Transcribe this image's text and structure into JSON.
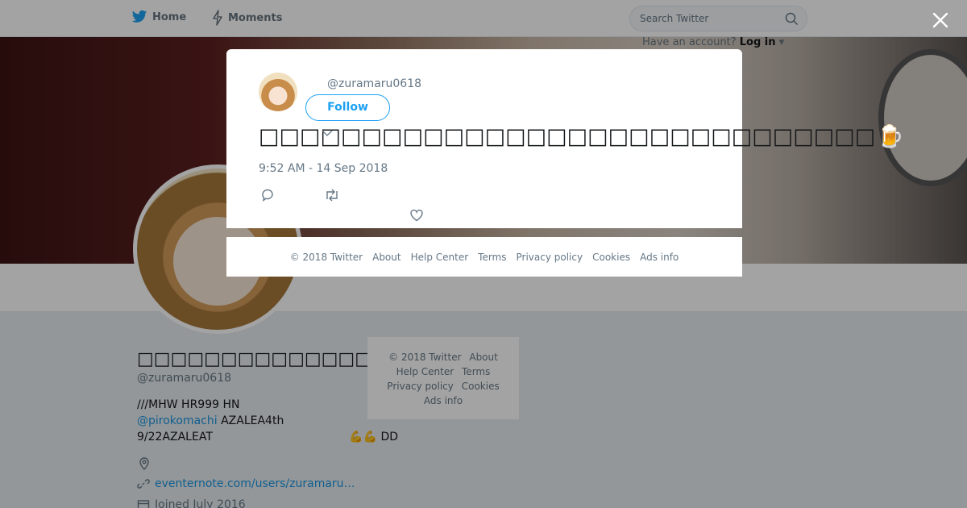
{
  "nav": {
    "home_label": "Home",
    "moments_label": "Moments",
    "search_placeholder": "Search Twitter",
    "login_prompt": "Have an account?",
    "login_label": "Log in"
  },
  "profile": {
    "display_name": "□□□□□□□□□□□□□□□□□□",
    "handle": "@zuramaru0618",
    "bio_line1": "///MHW HR999 HN",
    "bio_mention": "@pirokomachi",
    "bio_line2_rest": " AZALEA4th",
    "bio_line3_left": "9/22AZALEAT",
    "bio_line3_right": "💪💪 DD",
    "website": "eventernote.com/users/zuramaru…",
    "joined": "Joined July 2016"
  },
  "side_footer": {
    "copyright": "© 2018 Twitter",
    "about": "About",
    "help": "Help Center",
    "terms": "Terms",
    "privacy": "Privacy policy",
    "cookies": "Cookies",
    "ads": "Ads info"
  },
  "modal": {
    "handle": "@zuramaru0618",
    "follow_label": "Follow",
    "tweet_text": "□□□□□□□□□□□□□□□□□□□□□□□□□□□□□□",
    "tweet_emoji": "🍺",
    "timestamp": "9:52 AM - 14 Sep 2018"
  },
  "modal_footer": {
    "copyright": "© 2018 Twitter",
    "about": "About",
    "help": "Help Center",
    "terms": "Terms",
    "privacy": "Privacy policy",
    "cookies": "Cookies",
    "ads": "Ads info"
  },
  "colors": {
    "accent": "#1da1f2",
    "link": "#1b95e0",
    "muted": "#657786"
  },
  "icons": [
    "twitter-bird-icon",
    "lightning-icon",
    "search-icon",
    "close-icon",
    "reply-icon",
    "retweet-icon",
    "like-icon",
    "location-icon",
    "link-icon",
    "calendar-icon",
    "chevron-down-icon"
  ]
}
